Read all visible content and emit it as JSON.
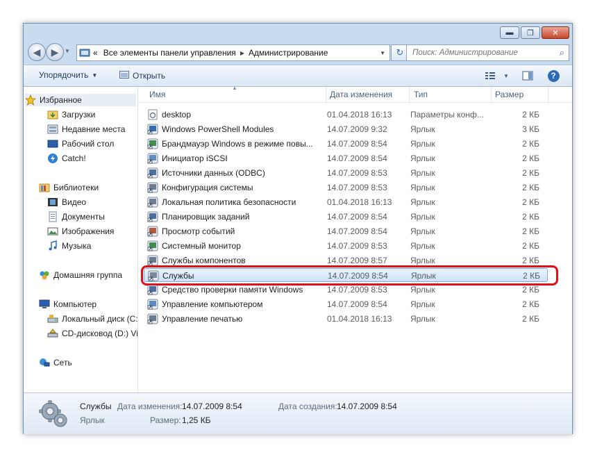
{
  "window": {
    "controls": {
      "minimize": "▬",
      "maximize": "❐",
      "close": "✕"
    }
  },
  "address_bar": {
    "prefix": "«",
    "segments": [
      "Все элементы панели управления",
      "Администрирование"
    ]
  },
  "search": {
    "placeholder": "Поиск: Администрирование"
  },
  "toolbar": {
    "organize_label": "Упорядочить",
    "open_label": "Открыть"
  },
  "nav": {
    "favorites": {
      "label": "Избранное",
      "items": [
        "Загрузки",
        "Недавние места",
        "Рабочий стол",
        "Catch!"
      ]
    },
    "libraries": {
      "label": "Библиотеки",
      "items": [
        "Видео",
        "Документы",
        "Изображения",
        "Музыка"
      ]
    },
    "homegroup": {
      "label": "Домашняя группа"
    },
    "computer": {
      "label": "Компьютер",
      "items": [
        "Локальный диск (C:",
        "CD-дисковод (D:) Vi"
      ]
    },
    "network": {
      "label": "Сеть"
    }
  },
  "columns": {
    "name": "Имя",
    "date": "Дата изменения",
    "type": "Тип",
    "size": "Размер"
  },
  "files": [
    {
      "name": "desktop",
      "date": "01.04.2018 16:13",
      "type": "Параметры конф...",
      "size": "2 КБ"
    },
    {
      "name": "Windows PowerShell Modules",
      "date": "14.07.2009 9:32",
      "type": "Ярлык",
      "size": "3 КБ"
    },
    {
      "name": "Брандмауэр Windows в режиме повы...",
      "date": "14.07.2009 8:54",
      "type": "Ярлык",
      "size": "2 КБ"
    },
    {
      "name": "Инициатор iSCSI",
      "date": "14.07.2009 8:54",
      "type": "Ярлык",
      "size": "2 КБ"
    },
    {
      "name": "Источники данных (ODBC)",
      "date": "14.07.2009 8:53",
      "type": "Ярлык",
      "size": "2 КБ"
    },
    {
      "name": "Конфигурация системы",
      "date": "14.07.2009 8:53",
      "type": "Ярлык",
      "size": "2 КБ"
    },
    {
      "name": "Локальная политика безопасности",
      "date": "01.04.2018 16:13",
      "type": "Ярлык",
      "size": "2 КБ"
    },
    {
      "name": "Планировщик заданий",
      "date": "14.07.2009 8:54",
      "type": "Ярлык",
      "size": "2 КБ"
    },
    {
      "name": "Просмотр событий",
      "date": "14.07.2009 8:54",
      "type": "Ярлык",
      "size": "2 КБ"
    },
    {
      "name": "Системный монитор",
      "date": "14.07.2009 8:53",
      "type": "Ярлык",
      "size": "2 КБ"
    },
    {
      "name": "Службы компонентов",
      "date": "14.07.2009 8:57",
      "type": "Ярлык",
      "size": "2 КБ"
    },
    {
      "name": "Службы",
      "date": "14.07.2009 8:54",
      "type": "Ярлык",
      "size": "2 КБ"
    },
    {
      "name": "Средство проверки памяти Windows",
      "date": "14.07.2009 8:53",
      "type": "Ярлык",
      "size": "2 КБ"
    },
    {
      "name": "Управление компьютером",
      "date": "14.07.2009 8:54",
      "type": "Ярлык",
      "size": "2 КБ"
    },
    {
      "name": "Управление печатью",
      "date": "01.04.2018 16:13",
      "type": "Ярлык",
      "size": "2 КБ"
    }
  ],
  "selected_file": "Службы",
  "details": {
    "name": "Службы",
    "type": "Ярлык",
    "modified_label": "Дата изменения:",
    "modified_value": "14.07.2009 8:54",
    "created_label": "Дата создания:",
    "created_value": "14.07.2009 8:54",
    "size_label": "Размер:",
    "size_value": "1,25 КБ"
  },
  "colors": {
    "highlight": "#e0101a",
    "selection": "#cde2f8",
    "window_frame": "#c9dcef"
  }
}
